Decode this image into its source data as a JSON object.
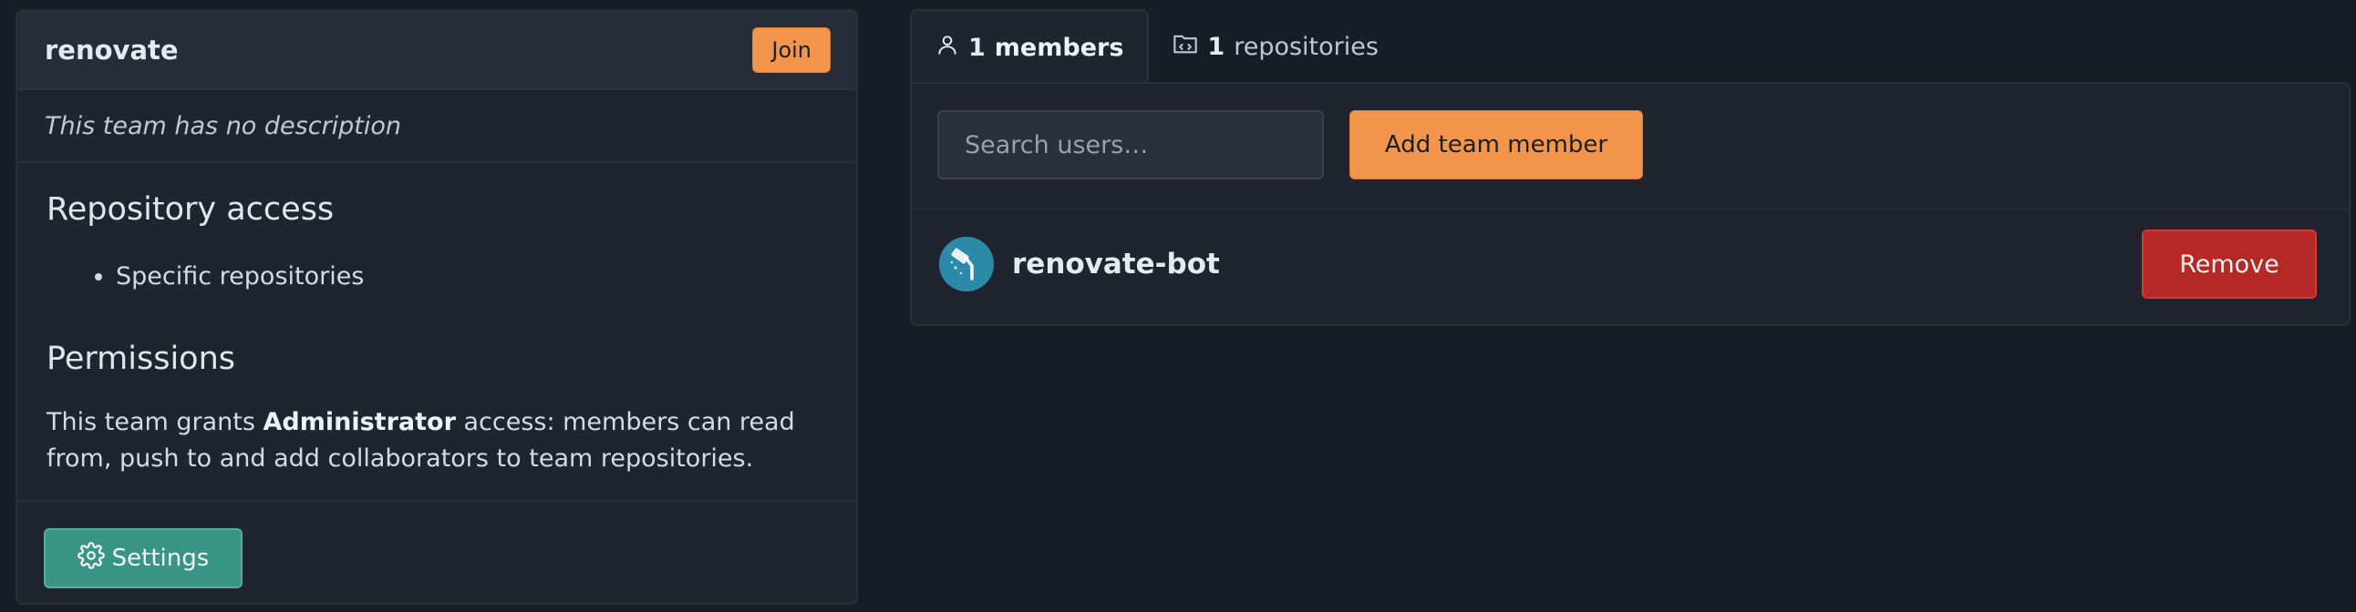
{
  "team": {
    "name": "renovate",
    "join_label": "Join",
    "description": "This team has no description",
    "repo_access_heading": "Repository access",
    "repo_access_items": [
      "Specific repositories"
    ],
    "permissions_heading": "Permissions",
    "permissions_pre": "This team grants ",
    "permissions_level": "Administrator",
    "permissions_post": " access: members can read from, push to and add collaborators to team repositories.",
    "settings_label": "Settings"
  },
  "tabs": [
    {
      "count": "1",
      "label": "members",
      "icon": "person-icon",
      "active": true
    },
    {
      "count": "1",
      "label": "repositories",
      "icon": "repo-icon",
      "active": false
    }
  ],
  "members_panel": {
    "search_placeholder": "Search users…",
    "add_label": "Add team member",
    "members": [
      {
        "name": "renovate-bot",
        "remove_label": "Remove"
      }
    ]
  },
  "colors": {
    "accent_orange": "#f3964b",
    "settings_teal": "#389584",
    "danger_red": "#b52826",
    "background": "#181c24"
  }
}
